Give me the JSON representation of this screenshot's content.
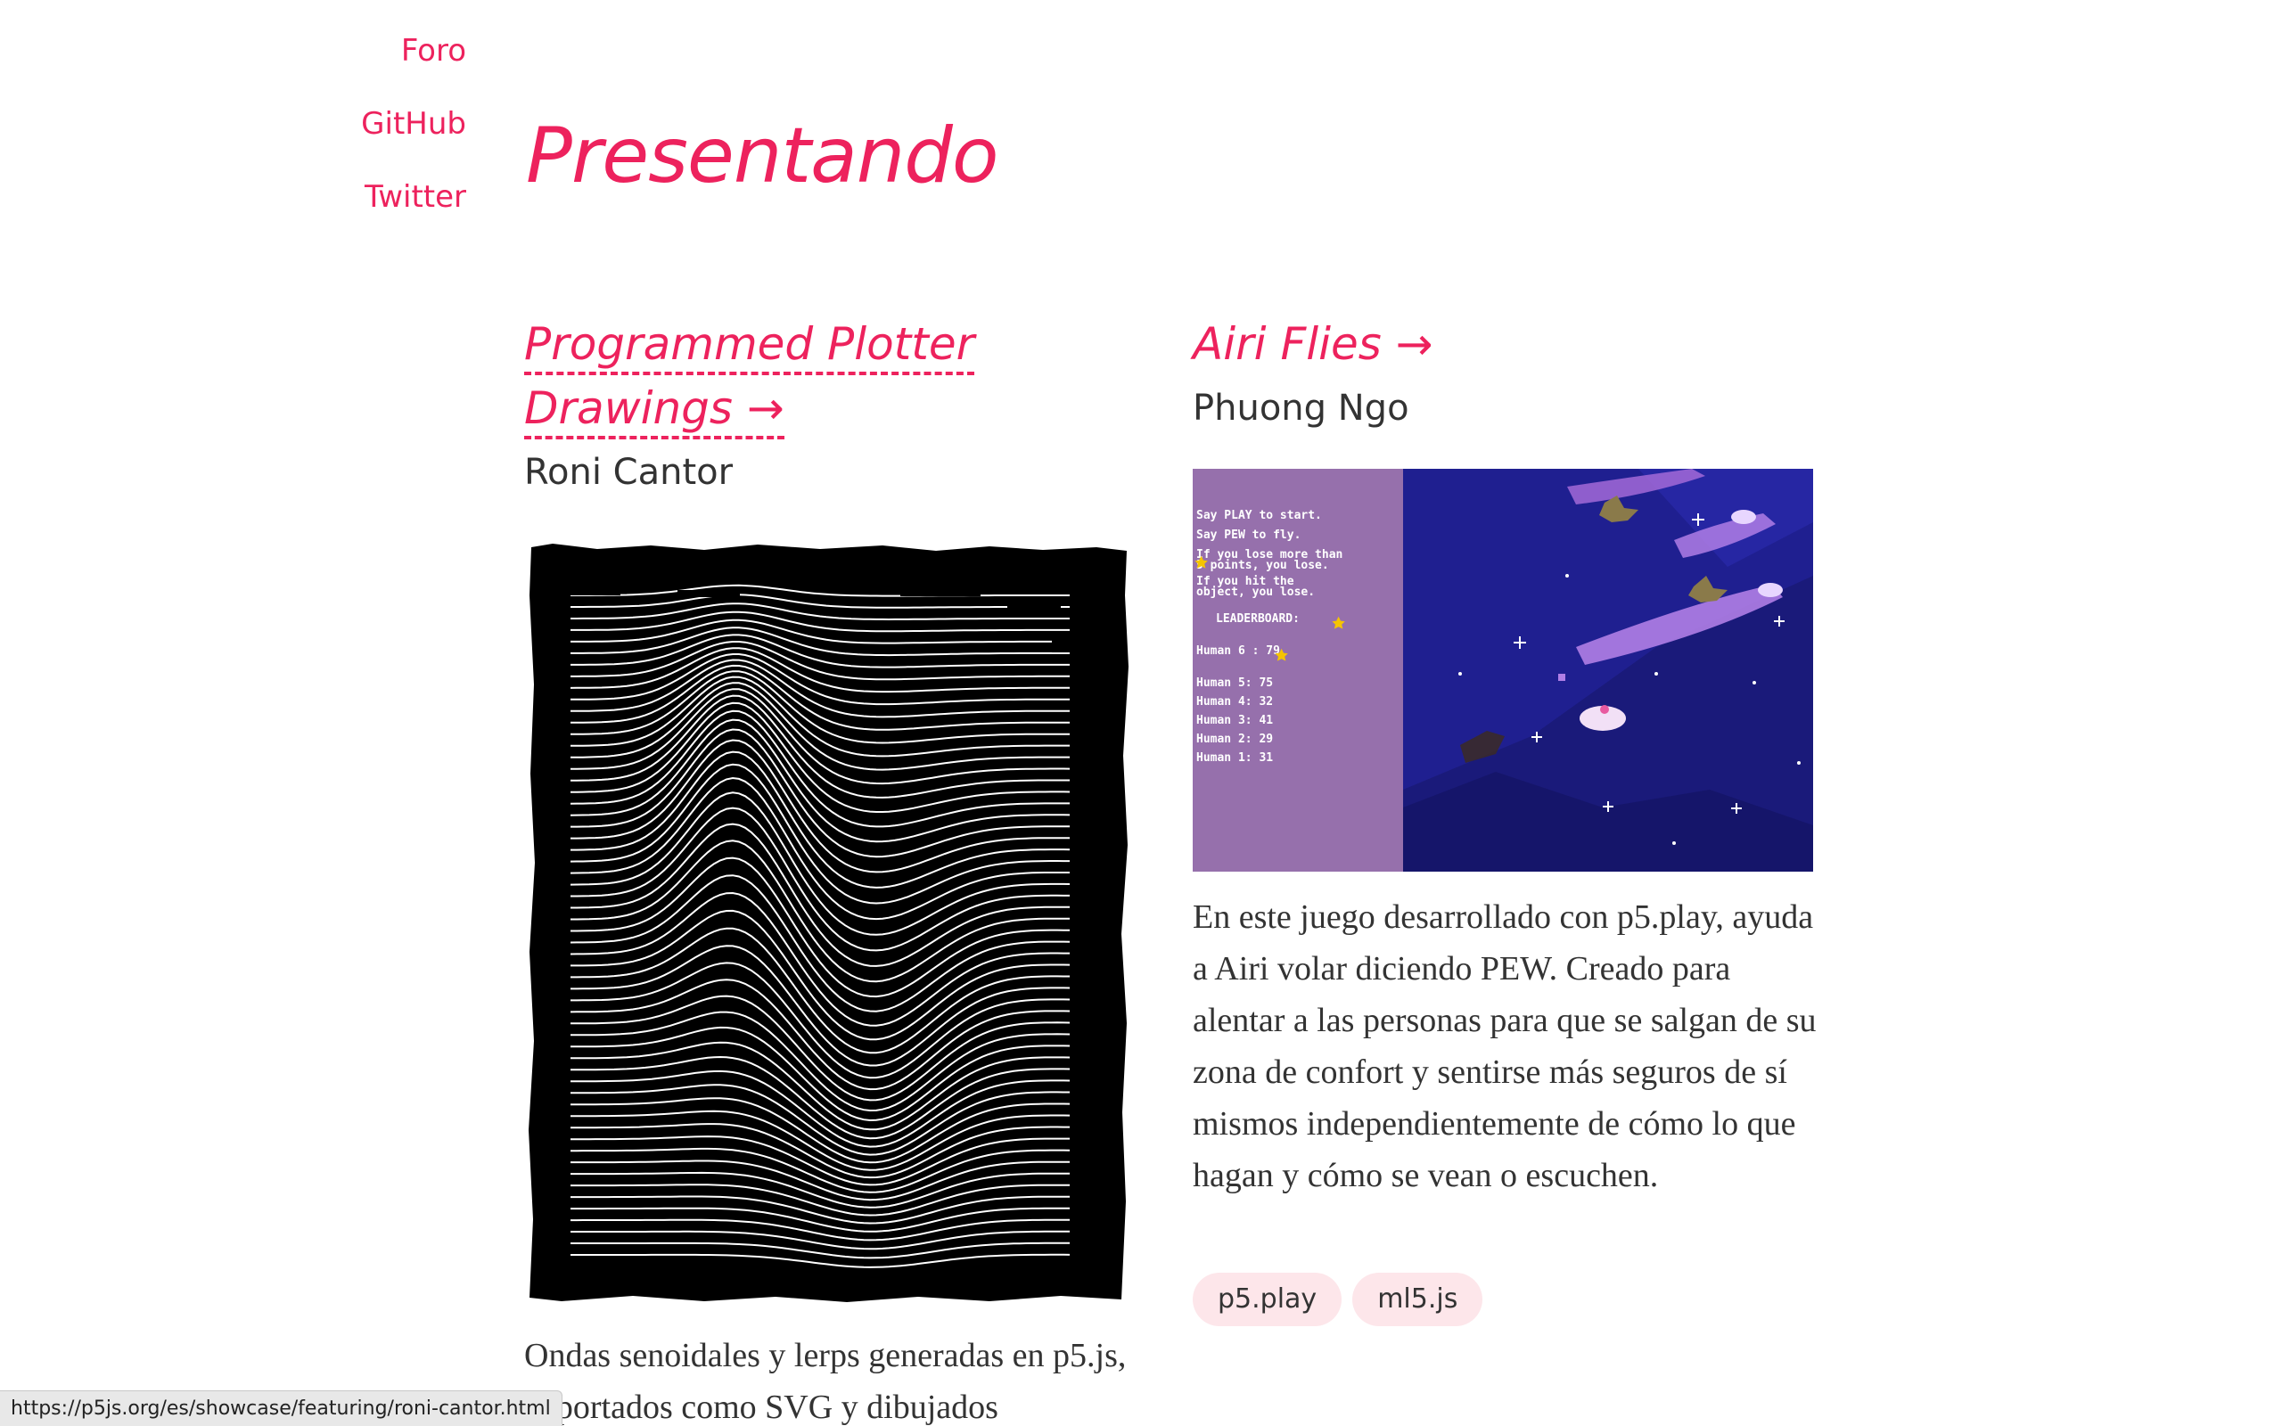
{
  "nav": {
    "items": [
      {
        "label": "Foro"
      },
      {
        "label": "GitHub"
      },
      {
        "label": "Twitter"
      }
    ]
  },
  "page": {
    "title": "Presentando"
  },
  "cards": [
    {
      "title": "Programmed Plotter Drawings →",
      "author": "Roni Cantor",
      "description": "Ondas senoidales y lerps generadas en p5.js, exportados como SVG y dibujados"
    },
    {
      "title": "Airi Flies →",
      "author": "Phuong Ngo",
      "description": "En este juego desarrollado con p5.play, ayuda a Airi volar diciendo PEW. Creado para alentar a las personas para que se salgan de su zona de confort y sentirse más seguros de sí mismos independientemente de cómo lo que hagan y cómo se vean o escuchen.",
      "tags": [
        "p5.play",
        "ml5.js"
      ],
      "game": {
        "instructions": [
          "Say PLAY to start.",
          "Say PEW to fly.",
          "If you lose more than",
          "5 points, you lose.",
          "If you hit the",
          "object, you lose."
        ],
        "leaderboard_title": "LEADERBOARD:",
        "current": "Human 6 : 79",
        "scores": [
          "Human 5: 75",
          "Human 4: 32",
          "Human 3: 41",
          "Human 2: 29",
          "Human 1: 31"
        ]
      }
    }
  ],
  "status_bar": {
    "url": "https://p5js.org/es/showcase/featuring/roni-cantor.html"
  },
  "colors": {
    "accent": "#ed225d",
    "tag_bg": "#fde6ea",
    "game_panel": "#9670ac",
    "space": "#1a1a7a"
  }
}
